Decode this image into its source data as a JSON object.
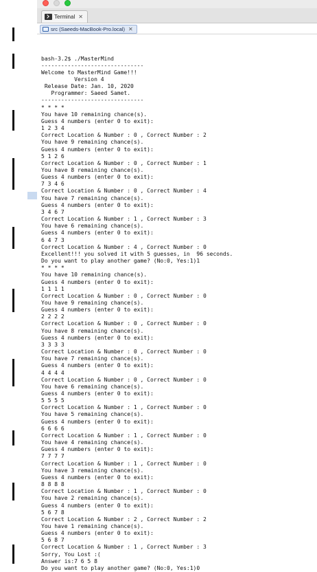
{
  "window": {
    "view_tab_label": "Terminal",
    "view_tab_close": "✕",
    "console_tab_label": "src (Saeeds-MacBook-Pro.local)",
    "console_tab_close": "✕"
  },
  "terminal": {
    "lines": [
      "bash-3.2$ ./MasterMind",
      "-------------------------------",
      "Welcome to MasterMind Game!!!",
      "          Version 4",
      " Release Date: Jan. 10, 2020",
      "   Programmer: Saeed Samet.",
      "-------------------------------",
      "* * * *",
      "You have 10 remaining chance(s).",
      "Guess 4 numbers (enter 0 to exit):",
      "1 2 3 4",
      "Correct Location & Number : 0 , Correct Number : 2",
      "You have 9 remaining chance(s).",
      "Guess 4 numbers (enter 0 to exit):",
      "5 1 2 6",
      "Correct Location & Number : 0 , Correct Number : 1",
      "You have 8 remaining chance(s).",
      "Guess 4 numbers (enter 0 to exit):",
      "7 3 4 6",
      "Correct Location & Number : 0 , Correct Number : 4",
      "You have 7 remaining chance(s).",
      "Guess 4 numbers (enter 0 to exit):",
      "3 4 6 7",
      "Correct Location & Number : 1 , Correct Number : 3",
      "You have 6 remaining chance(s).",
      "Guess 4 numbers (enter 0 to exit):",
      "6 4 7 3",
      "Correct Location & Number : 4 , Correct Number : 0",
      "Excellent!!! you solved it with 5 guesses, in  96 seconds.",
      "Do you want to play another game? (No:0, Yes:1)1",
      "* * * *",
      "You have 10 remaining chance(s).",
      "Guess 4 numbers (enter 0 to exit):",
      "1 1 1 1",
      "Correct Location & Number : 0 , Correct Number : 0",
      "You have 9 remaining chance(s).",
      "Guess 4 numbers (enter 0 to exit):",
      "2 2 2 2",
      "Correct Location & Number : 0 , Correct Number : 0",
      "You have 8 remaining chance(s).",
      "Guess 4 numbers (enter 0 to exit):",
      "3 3 3 3",
      "Correct Location & Number : 0 , Correct Number : 0",
      "You have 7 remaining chance(s).",
      "Guess 4 numbers (enter 0 to exit):",
      "4 4 4 4",
      "Correct Location & Number : 0 , Correct Number : 0",
      "You have 6 remaining chance(s).",
      "Guess 4 numbers (enter 0 to exit):",
      "5 5 5 5",
      "Correct Location & Number : 1 , Correct Number : 0",
      "You have 5 remaining chance(s).",
      "Guess 4 numbers (enter 0 to exit):",
      "6 6 6 6",
      "Correct Location & Number : 1 , Correct Number : 0",
      "You have 4 remaining chance(s).",
      "Guess 4 numbers (enter 0 to exit):",
      "7 7 7 7",
      "Correct Location & Number : 1 , Correct Number : 0",
      "You have 3 remaining chance(s).",
      "Guess 4 numbers (enter 0 to exit):",
      "8 8 8 8",
      "Correct Location & Number : 1 , Correct Number : 0",
      "You have 2 remaining chance(s).",
      "Guess 4 numbers (enter 0 to exit):",
      "5 6 7 8",
      "Correct Location & Number : 2 , Correct Number : 2",
      "You have 1 remaining chance(s).",
      "Guess 4 numbers (enter 0 to exit):",
      "5 6 8 7",
      "Correct Location & Number : 1 , Correct Number : 3",
      "Sorry, You Lost :(",
      "Answer is:7 6 5 8",
      "Do you want to play another game? (No:0, Yes:1)0"
    ],
    "prompt": "bash-3.2$ "
  }
}
